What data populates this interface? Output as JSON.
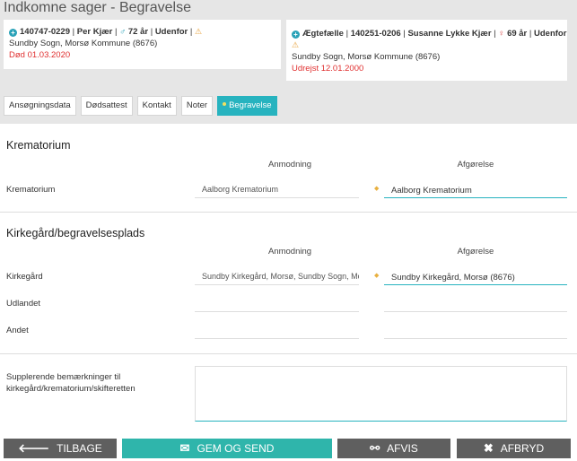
{
  "page_title": "Indkomne sager - Begravelse",
  "person1": {
    "cpr": "140747-0229",
    "name": "Per Kjær",
    "age": "72 år",
    "location_status": "Udenfor",
    "address": "Sundby Sogn, Morsø Kommune (8676)",
    "status": "Død 01.03.2020"
  },
  "person2": {
    "relation": "Ægtefælle",
    "cpr": "140251-0206",
    "name": "Susanne Lykke Kjær",
    "age": "69 år",
    "location_status": "Udenfor",
    "address": "Sundby Sogn, Morsø Kommune (8676)",
    "status": "Udrejst 12.01.2000"
  },
  "tabs": [
    "Ansøgningsdata",
    "Dødsattest",
    "Kontakt",
    "Noter",
    "Begravelse"
  ],
  "sections": {
    "krematorium": {
      "title": "Krematorium",
      "col_request": "Anmodning",
      "col_decision": "Afgørelse",
      "row_label": "Krematorium",
      "request_value": "Aalborg Krematorium",
      "decision_value": "Aalborg Krematorium"
    },
    "kirkegaard": {
      "title": "Kirkegård/begravelsesplads",
      "col_request": "Anmodning",
      "col_decision": "Afgørelse",
      "rows": [
        {
          "label": "Kirkegård",
          "request": "Sundby Kirkegård, Morsø, Sundby Sogn, Mo",
          "decision": "Sundby Kirkegård, Morsø (8676)"
        },
        {
          "label": "Udlandet",
          "request": "",
          "decision": ""
        },
        {
          "label": "Andet",
          "request": "",
          "decision": ""
        }
      ]
    },
    "remarks": {
      "label_line1": "Supplerende bemærkninger til",
      "label_line2": "kirkegård/krematorium/skifteretten",
      "value": ""
    }
  },
  "footer": {
    "back": "TILBAGE",
    "save": "GEM OG SEND",
    "reject": "AFVIS",
    "cancel": "AFBRYD"
  },
  "colors": {
    "accent": "#27b3bf",
    "footer_grey": "#5f5f5f",
    "footer_teal": "#2fb5ab",
    "alert_red": "#e03030"
  }
}
